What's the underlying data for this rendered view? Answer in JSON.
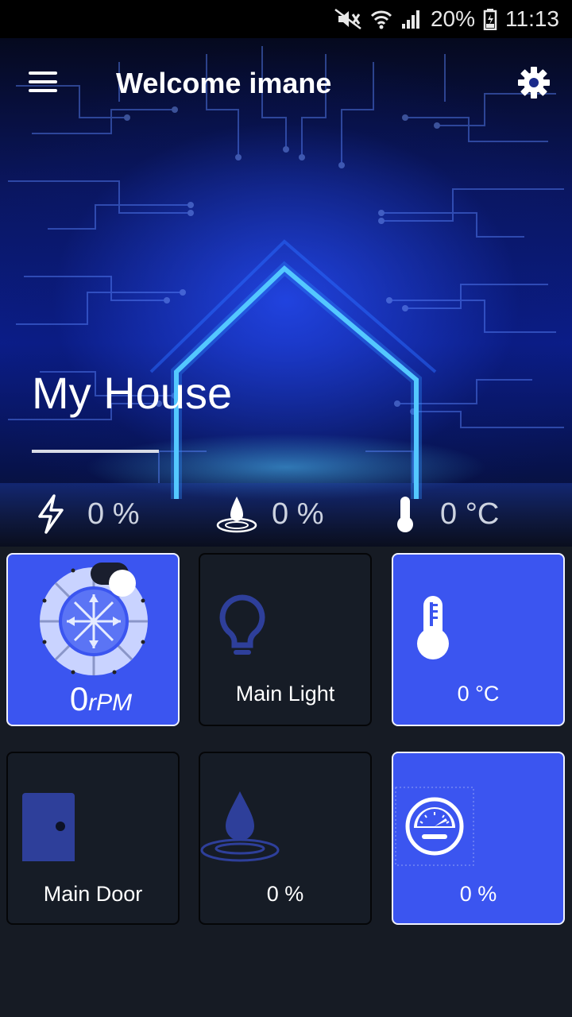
{
  "status_bar": {
    "battery": "20%",
    "time": "11:13"
  },
  "header": {
    "title": "Welcome imane",
    "menu_icon": "hamburger-menu-icon",
    "settings_icon": "gear-icon"
  },
  "hero": {
    "house_name": "My House"
  },
  "summary": {
    "power": "0 %",
    "water": "0 %",
    "temperature": "0 °C"
  },
  "tiles": {
    "fan": {
      "speed_value": "0",
      "speed_unit": "rPM"
    },
    "light": {
      "label": "Main Light"
    },
    "temperature": {
      "value": "0 °C"
    },
    "door": {
      "label": "Main Door"
    },
    "water": {
      "value": "0 %"
    },
    "gauge": {
      "value": "0 %"
    }
  },
  "colors": {
    "accent": "#3b55f0",
    "card_dark": "#161c26",
    "background": "#161b24"
  }
}
